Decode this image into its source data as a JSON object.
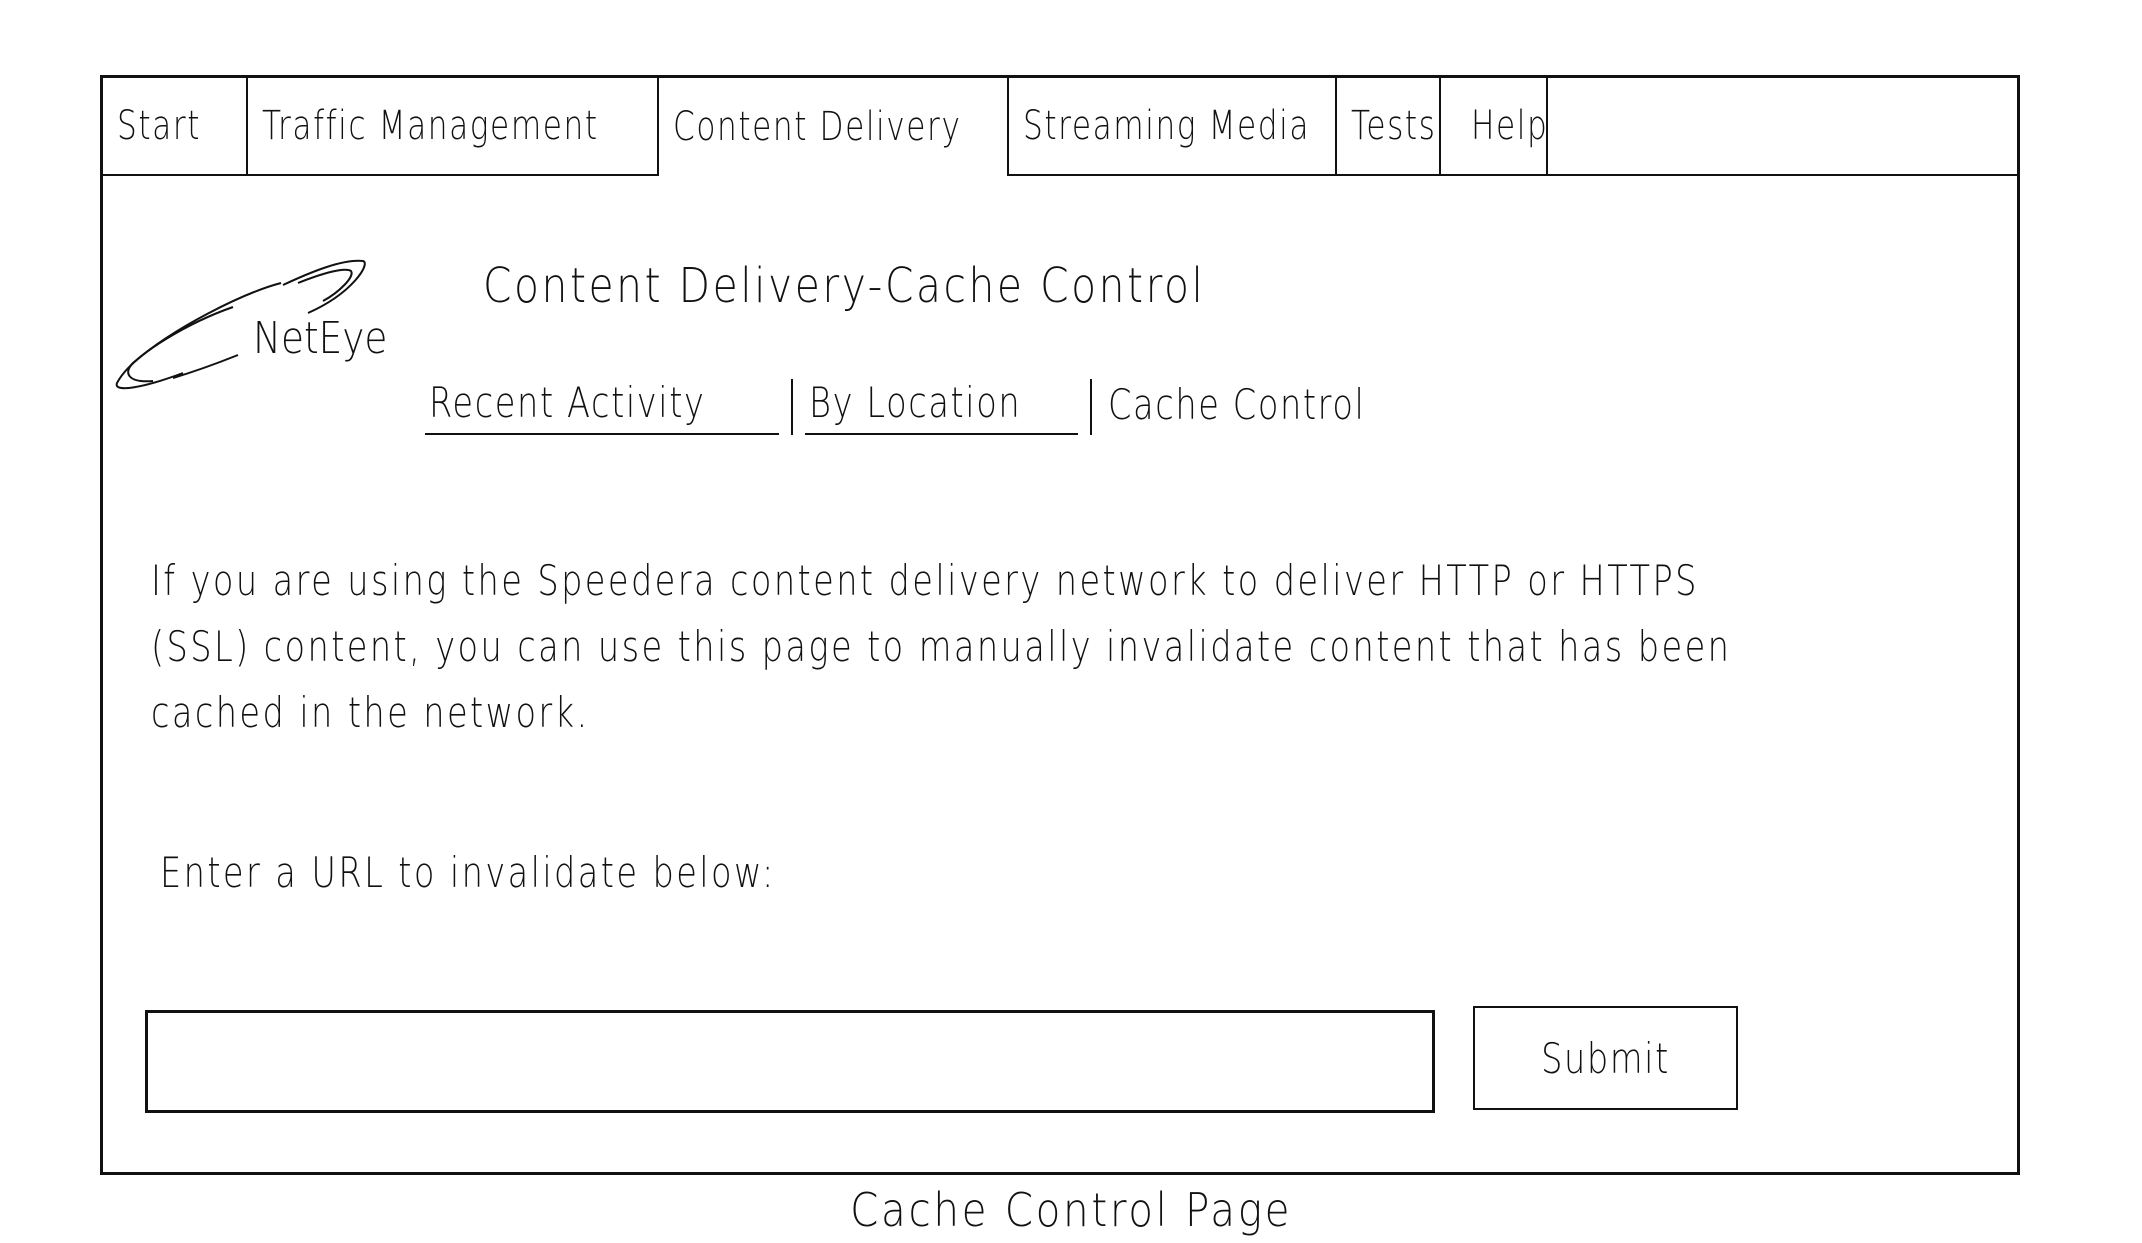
{
  "tabs": [
    {
      "label": "Start",
      "active": false
    },
    {
      "label": "Traffic Management",
      "active": false
    },
    {
      "label": "Content Delivery",
      "active": true
    },
    {
      "label": "Streaming Media",
      "active": false
    },
    {
      "label": "Tests",
      "active": false
    },
    {
      "label": "Help",
      "active": false
    }
  ],
  "logo": {
    "text": "NetEye"
  },
  "page_title": "Content Delivery-Cache Control",
  "subnav": {
    "items": [
      {
        "label": "Recent Activity",
        "link": true
      },
      {
        "label": "By Location",
        "link": true
      },
      {
        "label": "Cache Control",
        "link": false
      }
    ]
  },
  "description": {
    "lines": [
      "If you are using the Speedera content delivery network to deliver HTTP or HTTPS",
      "(SSL) content, you can use this page to manually invalidate content that has been",
      "cached in the network."
    ]
  },
  "form": {
    "prompt": "Enter a URL to invalidate below:",
    "url_value": "",
    "url_placeholder": "",
    "submit_label": "Submit"
  },
  "caption": "Cache Control Page"
}
